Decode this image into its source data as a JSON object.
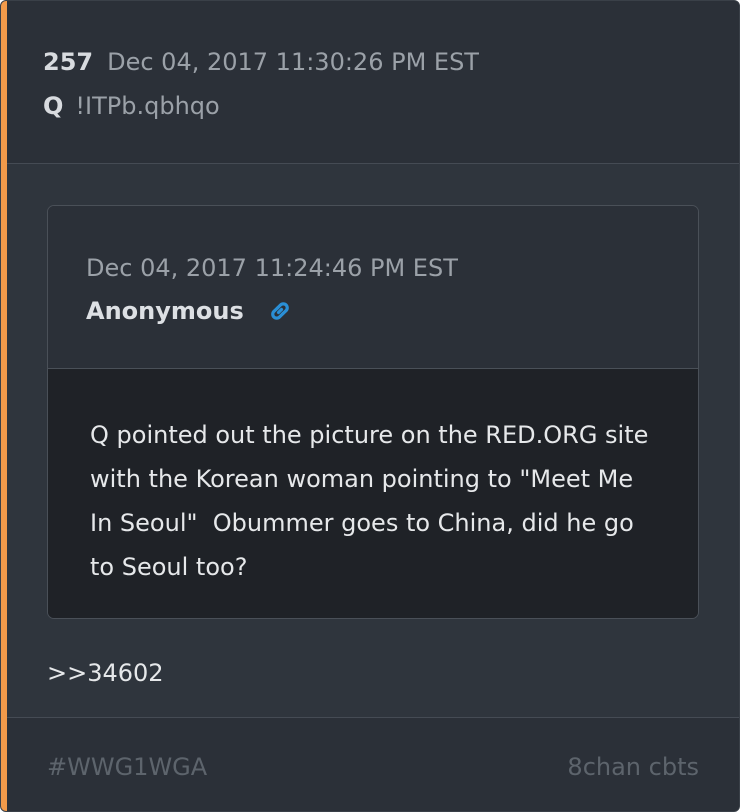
{
  "post": {
    "number": "257",
    "date": "Dec 04, 2017 11:30:26 PM EST",
    "author": "Q",
    "tripcode": "!ITPb.qbhqo",
    "accent_color": "#f29a4a"
  },
  "quoted_post": {
    "date": "Dec 04, 2017 11:24:46 PM EST",
    "author": "Anonymous",
    "link_icon": "link-icon",
    "text": "Q pointed out the picture on the RED.ORG site\nwith the Korean woman pointing to \"Meet Me\nIn Seoul\"  Obummer goes to China, did he go\nto Seoul too?"
  },
  "reply_ref": ">>34602",
  "footer": {
    "hashtag": "#WWG1WGA",
    "source": "8chan cbts"
  }
}
